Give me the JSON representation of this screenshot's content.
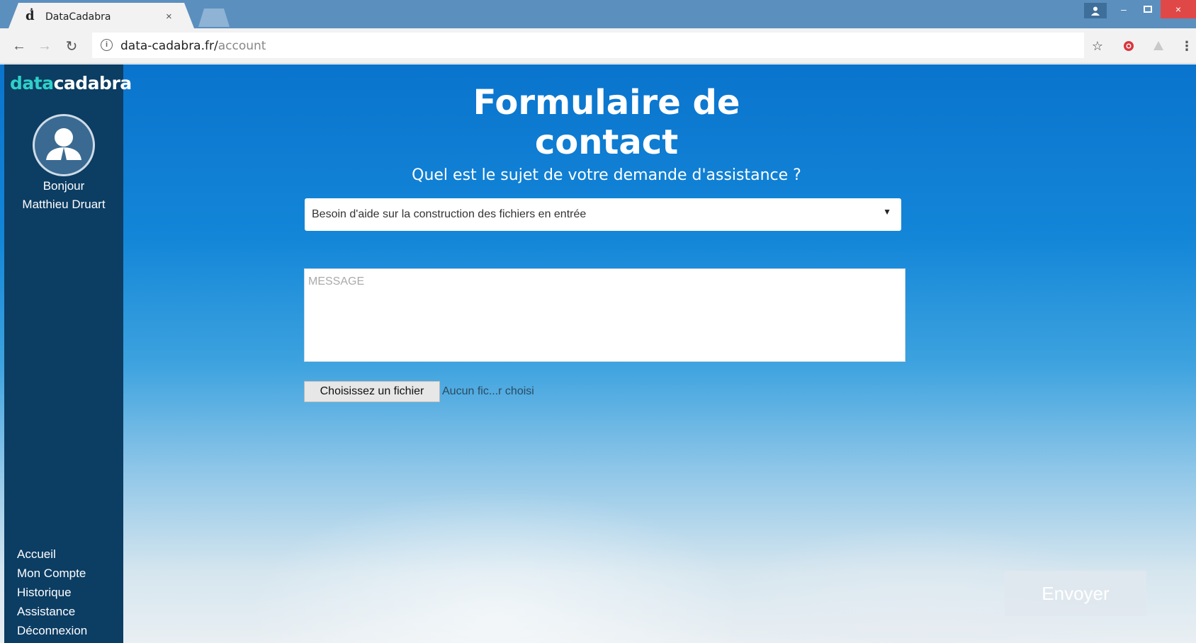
{
  "browser": {
    "tab_title": "DataCadabra",
    "tab_close": "×",
    "url_host": "data-cadabra.fr/",
    "url_path": "account",
    "window_close": "×",
    "window_minimize": "–",
    "window_maximize": "▫"
  },
  "sidebar": {
    "logo_part1": "data",
    "logo_part2": "cadabra",
    "greeting": "Bonjour",
    "user_name": "Matthieu Druart",
    "nav": [
      {
        "label": "Accueil"
      },
      {
        "label": "Mon Compte"
      },
      {
        "label": "Historique"
      },
      {
        "label": "Assistance"
      },
      {
        "label": "Déconnexion"
      }
    ]
  },
  "form": {
    "title": "Formulaire de contact",
    "question": "Quel est le sujet de votre demande d'assistance ?",
    "subject_selected": "Besoin d'aide sur la construction des fichiers en entrée",
    "message_placeholder": "MESSAGE",
    "file_button": "Choisissez un fichier",
    "file_status": "Aucun fic...r choisi",
    "submit": "Envoyer"
  },
  "colors": {
    "sidebar_bg": "#0c3d63",
    "page_top": "#0a74cd",
    "logo_accent": "#2fd0c8",
    "tabstrip": "#5b8fbe",
    "close_red": "#e04848"
  },
  "icons": [
    "back-arrow-icon",
    "forward-arrow-icon",
    "reload-icon",
    "info-icon",
    "star-icon",
    "extension-icon",
    "user-avatar-icon"
  ]
}
